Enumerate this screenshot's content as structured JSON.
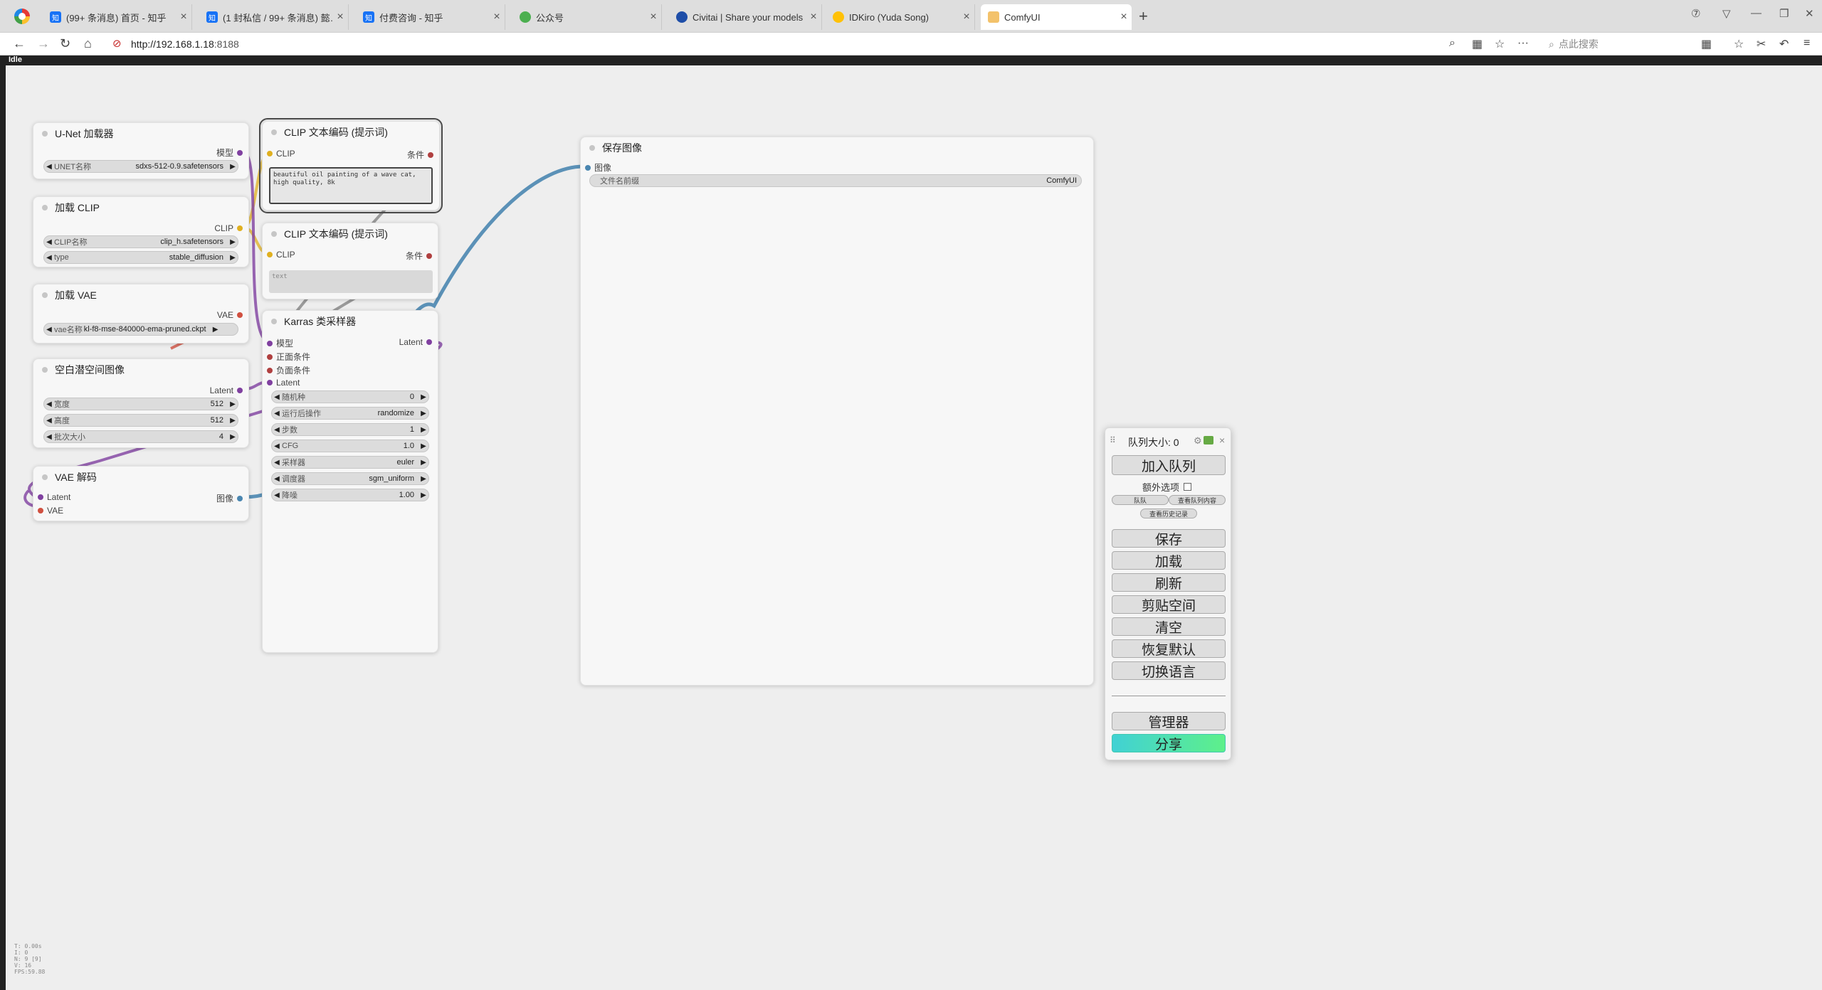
{
  "browser": {
    "tabs": [
      {
        "label": "(99+ 条消息) 首页 - 知乎",
        "icon": "zhihu-icon"
      },
      {
        "label": "(1 封私信 / 99+ 条消息) 懿…",
        "icon": "zhihu-icon"
      },
      {
        "label": "付费咨询 - 知乎",
        "icon": "zhihu-icon"
      },
      {
        "label": "公众号",
        "icon": "wechat-icon"
      },
      {
        "label": "Civitai | Share your models",
        "icon": "civitai-icon"
      },
      {
        "label": "IDKiro (Yuda Song)",
        "icon": "huggingface-icon"
      },
      {
        "label": "ComfyUI",
        "icon": "comfyui-icon"
      }
    ],
    "url_host": "http://192.168.1.18",
    "url_port": ":8188",
    "search_placeholder": "点此搜索",
    "status": "Idle"
  },
  "nodes": {
    "unet": {
      "title": "U-Net 加载器",
      "out": "模型",
      "w_label": "UNET名称",
      "w_value": "sdxs-512-0.9.safetensors"
    },
    "clip_loader": {
      "title": "加载 CLIP",
      "out": "CLIP",
      "w1_label": "CLIP名称",
      "w1_value": "clip_h.safetensors",
      "w2_label": "type",
      "w2_value": "stable_diffusion"
    },
    "vae_loader": {
      "title": "加载 VAE",
      "out": "VAE",
      "w_label": "vae名称",
      "w_value": "kl-f8-mse-840000-ema-pruned.ckpt"
    },
    "latent": {
      "title": "空白潜空间图像",
      "out": "Latent",
      "w1_label": "宽度",
      "w1_value": "512",
      "w2_label": "高度",
      "w2_value": "512",
      "w3_label": "批次大小",
      "w3_value": "4"
    },
    "vae_decode": {
      "title": "VAE 解码",
      "in1": "Latent",
      "in2": "VAE",
      "out": "图像"
    },
    "clip_pos": {
      "title": "CLIP 文本编码 (提示词)",
      "in": "CLIP",
      "out": "条件",
      "text": "beautiful oil painting of a wave cat, high quality, 8k"
    },
    "clip_neg": {
      "title": "CLIP 文本编码 (提示词)",
      "in": "CLIP",
      "out": "条件",
      "text": "text"
    },
    "sampler": {
      "title": "Karras 类采样器",
      "inputs": [
        "模型",
        "正面条件",
        "负面条件",
        "Latent"
      ],
      "out": "Latent",
      "widgets": [
        {
          "label": "随机种",
          "value": "0"
        },
        {
          "label": "运行后操作",
          "value": "randomize"
        },
        {
          "label": "步数",
          "value": "1"
        },
        {
          "label": "CFG",
          "value": "1.0"
        },
        {
          "label": "采样器",
          "value": "euler"
        },
        {
          "label": "调度器",
          "value": "sgm_uniform"
        },
        {
          "label": "降噪",
          "value": "1.00"
        }
      ]
    },
    "save": {
      "title": "保存图像",
      "in": "图像",
      "w_label": "文件名前缀",
      "w_value": "ComfyUI"
    }
  },
  "panel": {
    "queue_size": "队列大小: 0",
    "queue_button": "加入队列",
    "extra_options": "额外选项",
    "small1": "队队",
    "small2": "查看队列内容",
    "small3": "查看历史记录",
    "buttons": [
      "保存",
      "加载",
      "刷新",
      "剪贴空间",
      "清空",
      "恢复默认",
      "切换语言"
    ],
    "manager": "管理器",
    "share": "分享"
  },
  "stats": [
    "T: 0.00s",
    "I: 0",
    "N: 9 [9]",
    "V: 16",
    "FPS:59.88"
  ],
  "colors": {
    "wire_clip": "#e0b020",
    "wire_model": "#8040a0",
    "wire_image": "#4a86b0",
    "wire_vae": "#d05040",
    "wire_cond": "#b04040",
    "share_start": "#41d1d4",
    "share_end": "#5ef08a"
  }
}
